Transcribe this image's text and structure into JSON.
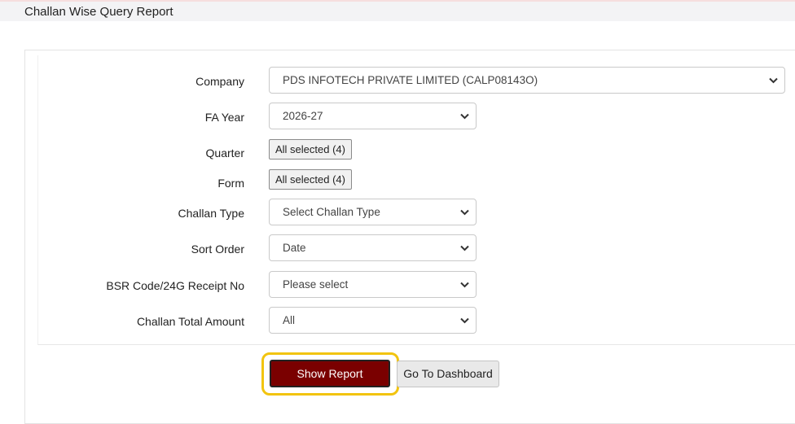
{
  "header": {
    "title": "Challan Wise Query Report"
  },
  "form": {
    "company": {
      "label": "Company",
      "value": "PDS INFOTECH PRIVATE LIMITED (CALP08143O)"
    },
    "fa_year": {
      "label": "FA Year",
      "value": "2026-27"
    },
    "quarter": {
      "label": "Quarter",
      "value": "All selected (4)"
    },
    "form_field": {
      "label": "Form",
      "value": "All selected (4)"
    },
    "challan_type": {
      "label": "Challan Type",
      "value": "Select Challan Type"
    },
    "sort_order": {
      "label": "Sort Order",
      "value": "Date"
    },
    "bsr_code": {
      "label": "BSR Code/24G Receipt No",
      "value": "Please select"
    },
    "challan_total": {
      "label": "Challan Total Amount",
      "value": "All"
    }
  },
  "actions": {
    "show_report": "Show Report",
    "go_to_dashboard": "Go To Dashboard"
  },
  "colors": {
    "primary_button": "#7a0000",
    "highlight": "#f2c40f"
  }
}
